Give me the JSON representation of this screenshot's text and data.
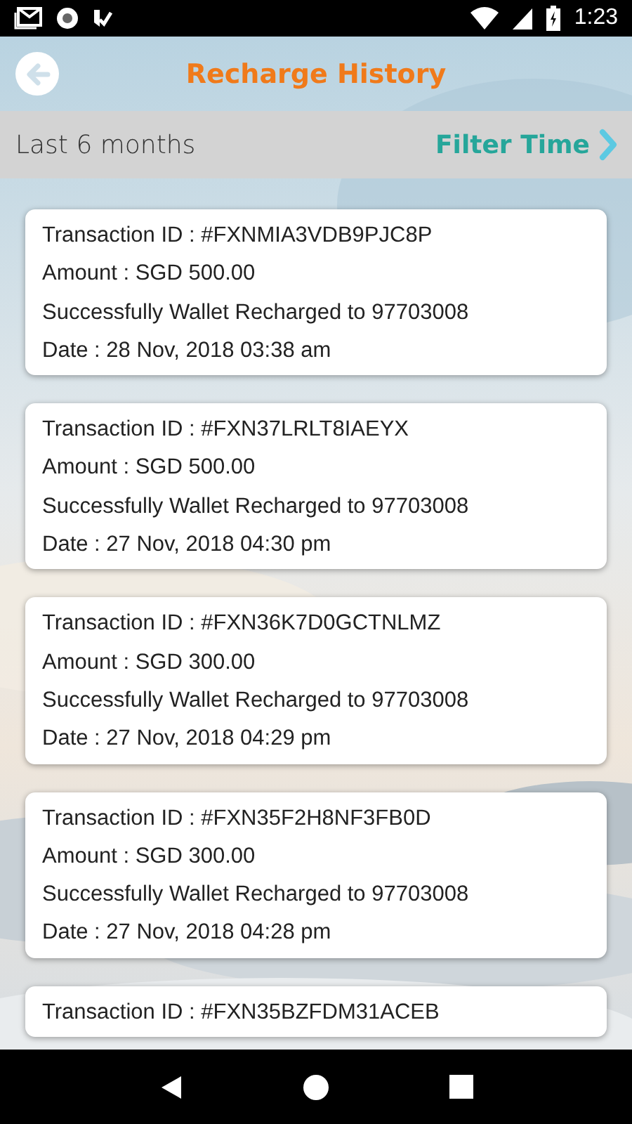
{
  "status_bar": {
    "time": "1:23"
  },
  "header": {
    "title": "Recharge History"
  },
  "filter_bar": {
    "range": "Last 6 months",
    "filter_label": "Filter Time"
  },
  "transactions": [
    {
      "id_line": "Transaction ID : #FXNMIA3VDB9PJC8P",
      "amount": "Amount : SGD 500.00",
      "message": "Successfully Wallet Recharged to 97703008",
      "date": "Date : 28 Nov, 2018 03:38 am"
    },
    {
      "id_line": "Transaction ID : #FXN37LRLT8IAEYX",
      "amount": "Amount : SGD 500.00",
      "message": "Successfully Wallet Recharged to 97703008",
      "date": "Date : 27 Nov, 2018 04:30 pm"
    },
    {
      "id_line": "Transaction ID : #FXN36K7D0GCTNLMZ",
      "amount": "Amount : SGD 300.00",
      "message": "Successfully Wallet Recharged to 97703008",
      "date": "Date : 27 Nov, 2018 04:29 pm"
    },
    {
      "id_line": "Transaction ID : #FXN35F2H8NF3FB0D",
      "amount": "Amount : SGD 300.00",
      "message": "Successfully Wallet Recharged to 97703008",
      "date": "Date : 27 Nov, 2018 04:28 pm"
    },
    {
      "id_line": "Transaction ID : #FXN35BZFDM31ACEB"
    }
  ]
}
